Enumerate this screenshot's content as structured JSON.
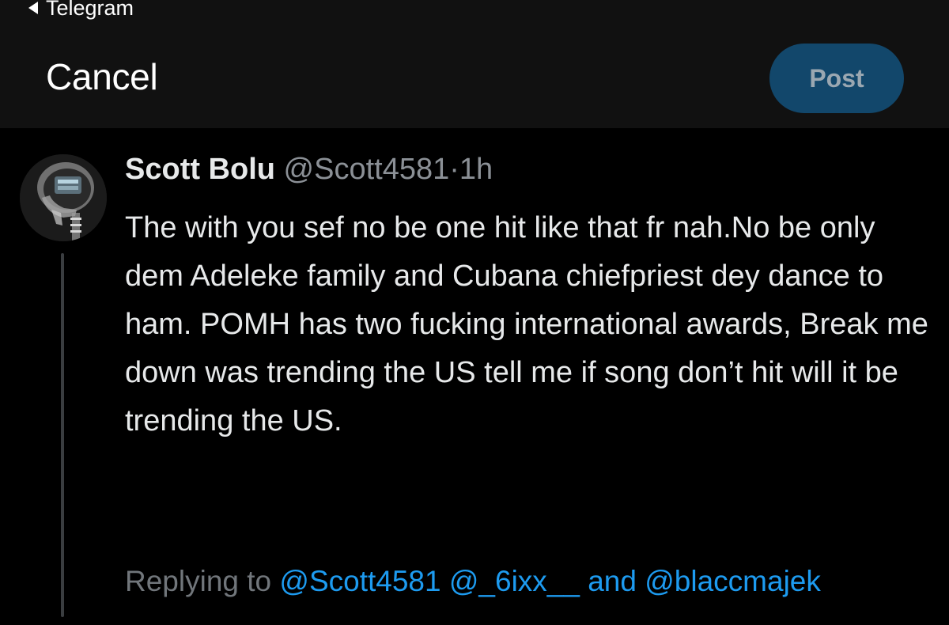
{
  "status_bar": {
    "back_label": "Telegram"
  },
  "header": {
    "cancel_label": "Cancel",
    "post_label": "Post"
  },
  "tweet": {
    "display_name": "Scott Bolu",
    "handle": "@Scott4581",
    "separator": "·",
    "time": "1h",
    "text": "The with you sef no be one hit like that fr nah.No be only dem Adeleke family and Cubana chiefpriest dey dance to ham. POMH has two fucking international awards, Break me down was trending the US tell me if song don’t hit will it be trending the US."
  },
  "replying": {
    "label": "Replying to",
    "mention_1": "@Scott4581",
    "mention_2": "@_6ixx__",
    "and": "and",
    "mention_3": "@blaccmajek"
  },
  "colors": {
    "background": "#000000",
    "header_bg": "#111111",
    "post_button": "#12476b",
    "link": "#1d9bf0",
    "muted": "#71767b"
  }
}
